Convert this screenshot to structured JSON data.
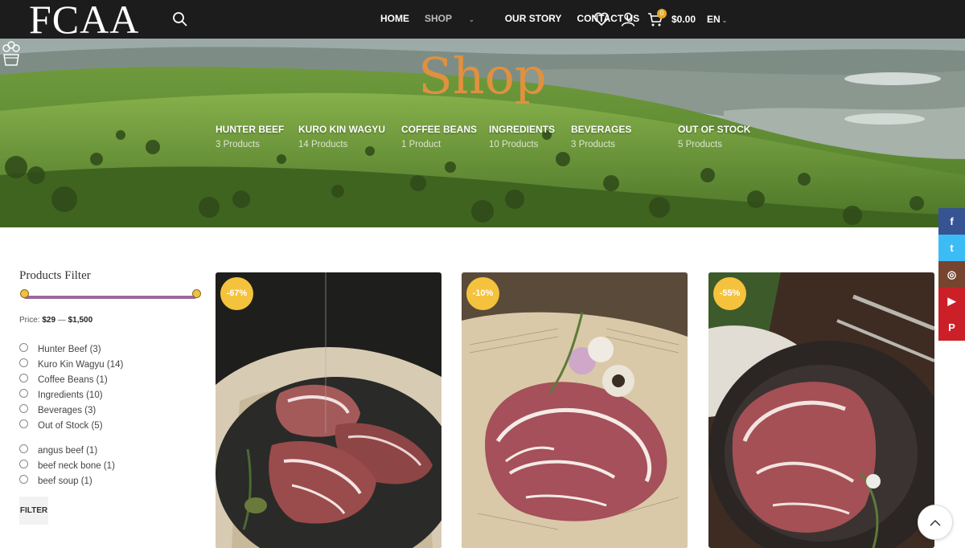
{
  "header": {
    "logo": "FCAA",
    "nav": [
      {
        "label": "HOME",
        "icon": ""
      },
      {
        "label": "SHOP",
        "icon": "chevron-down-icon"
      },
      {
        "label": "OUR STORY",
        "icon": ""
      },
      {
        "label": "CONTACT US",
        "icon": ""
      }
    ],
    "cart_count": "0",
    "cart_total": "$0.00",
    "language": "EN",
    "icons": [
      "search-icon",
      "heart-icon",
      "user-icon",
      "cart-icon"
    ]
  },
  "hero": {
    "title": "Shop",
    "categories": [
      {
        "name": "HUNTER BEEF",
        "count": "3 Products"
      },
      {
        "name": "KURO KIN WAGYU",
        "count": "14 Products"
      },
      {
        "name": "COFFEE BEANS",
        "count": "1 Product"
      },
      {
        "name": "INGREDIENTS",
        "count": "10 Products"
      },
      {
        "name": "BEVERAGES",
        "count": "3 Products"
      },
      {
        "name": "OUT OF STOCK",
        "count": "5 Products"
      }
    ]
  },
  "filter": {
    "heading": "Products Filter",
    "price_label": "Price:",
    "price_min": "$29",
    "price_sep": "—",
    "price_max": "$1,500",
    "categories": [
      "Hunter Beef (3)",
      "Kuro Kin Wagyu (14)",
      "Coffee Beans (1)",
      "Ingredients (10)",
      "Beverages (3)",
      "Out of Stock (5)"
    ],
    "tags": [
      "angus beef (1)",
      "beef neck bone (1)",
      "beef soup (1)"
    ],
    "button": "FILTER"
  },
  "products": [
    {
      "badge": "-67%"
    },
    {
      "badge": "-10%"
    },
    {
      "badge": "-55%"
    }
  ],
  "social": [
    {
      "icon": "facebook-icon",
      "glyph": "f",
      "color": "#365493"
    },
    {
      "icon": "twitter-icon",
      "glyph": "t",
      "color": "#3cbcf6"
    },
    {
      "icon": "instagram-icon",
      "glyph": "◎",
      "color": "#774430"
    },
    {
      "icon": "youtube-icon",
      "glyph": "▶",
      "color": "#cb2027"
    },
    {
      "icon": "pinterest-icon",
      "glyph": "P",
      "color": "#cb2027"
    }
  ],
  "colors": {
    "accent": "#e0913f",
    "badge": "#f4c23c",
    "header_bg": "#1c1c1c",
    "slider": "#9b6a9b"
  }
}
